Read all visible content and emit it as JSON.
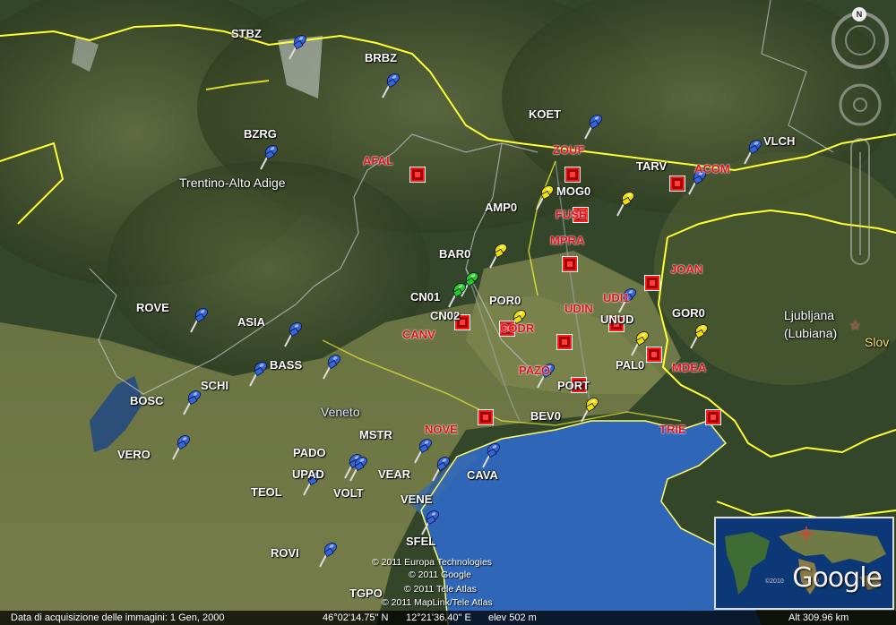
{
  "map": {
    "regions": [
      {
        "id": "trentino",
        "label": "Trentino-Alto Adige"
      },
      {
        "id": "veneto",
        "label": "Veneto"
      },
      {
        "id": "ljubljana",
        "label": "Ljubljana\n(Lubiana)"
      },
      {
        "id": "slovenia",
        "label": "Slov"
      }
    ],
    "stations_white": [
      "STBZ",
      "BRBZ",
      "BZRG",
      "KOET",
      "VLCH",
      "TARV",
      "MOG0",
      "AMP0",
      "BAR0",
      "CN01",
      "CN02",
      "POR0",
      "UNUD",
      "GOR0",
      "PAL0",
      "PORT",
      "BEV0",
      "ROVE",
      "ASIA",
      "BASS",
      "SCHI",
      "BOSC",
      "VERO",
      "MSTR",
      "PADO",
      "UPAD",
      "VOLT",
      "TEOL",
      "VEAR",
      "CAVA",
      "VENE",
      "SFEL",
      "ROVI",
      "TGPO"
    ],
    "stations_red": [
      "AFAL",
      "ZOUF",
      "ACOM",
      "FUSE",
      "MPRA",
      "JOAN",
      "UDI1",
      "UDIN",
      "CANV",
      "CODR",
      "PAZO",
      "MDEA",
      "NOVE",
      "TRIE"
    ],
    "credits": [
      "© 2011 Europa Technologies",
      "© 2011 Google",
      "© 2011 Tele Atlas",
      "© 2011 MapLink/Tele Atlas"
    ]
  },
  "status_bar": {
    "acquisition": "Data di acquisizione delle immagini:  1 Gen, 2000",
    "lat": "46°02'14.75\" N",
    "lon": "12°21'36.40\" E",
    "elev": "elev  502 m",
    "alt": "Alt  309.96 km"
  },
  "overview_map": {
    "logo": "Google",
    "year": "©2010"
  },
  "nav": {
    "north_label": "N"
  },
  "colors": {
    "pin_blue": "#3366dd",
    "pin_yellow": "#f0e000",
    "pin_green": "#22cc22",
    "marker_red": "#e0101c",
    "border_yellow": "#ffff33",
    "sea": "#2f66b8"
  }
}
